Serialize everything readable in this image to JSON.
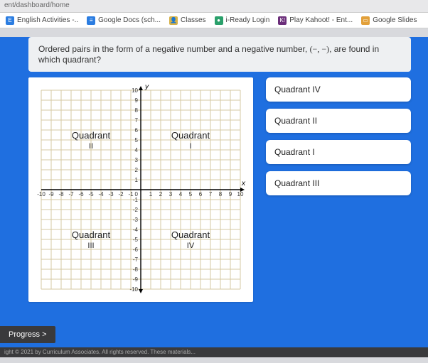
{
  "url": "ent/dashboard/home",
  "bookmarks": [
    {
      "label": "English Activities -..",
      "color": "#2b7de1",
      "glyph": "E"
    },
    {
      "label": "Google Docs (sch...",
      "color": "#2b7de1",
      "glyph": "≡"
    },
    {
      "label": "Classes",
      "color": "#d6b24a",
      "glyph": "👤"
    },
    {
      "label": "i-Ready Login",
      "color": "#2aa06b",
      "glyph": "●"
    },
    {
      "label": "Play Kahoot! - Ent...",
      "color": "#6b2e7a",
      "glyph": "K!"
    },
    {
      "label": "Google Slides",
      "color": "#e2a03a",
      "glyph": "▭"
    }
  ],
  "question_pre": "Ordered pairs in the form of a negative number and a negative number, ",
  "question_notation": "(−, −)",
  "question_post": ", are found in which quadrant?",
  "chart_data": {
    "type": "diagram",
    "title": "Coordinate Plane Quadrants",
    "xlabel": "x",
    "ylabel": "y",
    "xlim": [
      -10,
      10
    ],
    "ylim": [
      -10,
      10
    ],
    "x_ticks": [
      -10,
      -9,
      -8,
      -7,
      -6,
      -5,
      -4,
      -3,
      -2,
      -1,
      0,
      1,
      2,
      3,
      4,
      5,
      6,
      7,
      8,
      9,
      10
    ],
    "y_ticks": [
      -10,
      -9,
      -8,
      -7,
      -6,
      -5,
      -4,
      -3,
      -2,
      -1,
      0,
      1,
      2,
      3,
      4,
      5,
      6,
      7,
      8,
      9,
      10
    ],
    "quadrants": [
      {
        "name": "Quadrant",
        "sub": "I",
        "cx": 5,
        "cy": 5
      },
      {
        "name": "Quadrant",
        "sub": "II",
        "cx": -5,
        "cy": 5
      },
      {
        "name": "Quadrant",
        "sub": "III",
        "cx": -5,
        "cy": -5
      },
      {
        "name": "Quadrant",
        "sub": "IV",
        "cx": 5,
        "cy": -5
      }
    ]
  },
  "answers": [
    "Quadrant IV",
    "Quadrant II",
    "Quadrant I",
    "Quadrant III"
  ],
  "progress_label": "Progress  >",
  "footer": "ight © 2021 by Curriculum Associates. All rights reserved. These materials..."
}
